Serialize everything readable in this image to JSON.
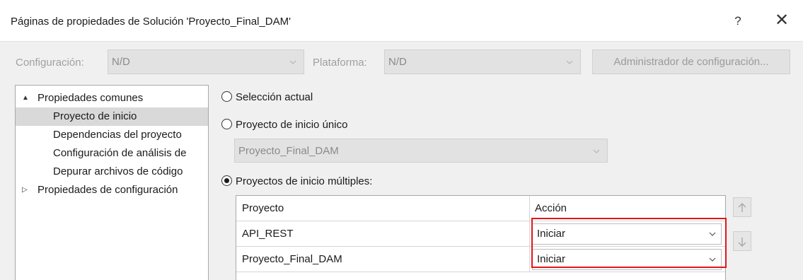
{
  "window": {
    "title": "Páginas de propiedades de Solución 'Proyecto_Final_DAM'",
    "help_label": "?",
    "close_label": "✕"
  },
  "toolbar": {
    "configuracion_label": "Configuración:",
    "configuracion_value": "N/D",
    "plataforma_label": "Plataforma:",
    "plataforma_value": "N/D",
    "admin_button": "Administrador de configuración..."
  },
  "tree": {
    "items": [
      {
        "label": "Propiedades comunes",
        "expander": "▲"
      },
      {
        "label": "Proyecto de inicio"
      },
      {
        "label": "Dependencias del proyecto"
      },
      {
        "label": "Configuración de análisis de"
      },
      {
        "label": "Depurar archivos de código"
      },
      {
        "label": "Propiedades de configuración",
        "expander": "▷"
      }
    ]
  },
  "startup": {
    "option_current": "Selección actual",
    "option_single": "Proyecto de inicio único",
    "single_value": "Proyecto_Final_DAM",
    "option_multiple": "Proyectos de inicio múltiples:"
  },
  "grid": {
    "col_project": "Proyecto",
    "col_action": "Acción",
    "rows": [
      {
        "project": "API_REST",
        "action": "Iniciar"
      },
      {
        "project": "Proyecto_Final_DAM",
        "action": "Iniciar"
      }
    ]
  },
  "colors": {
    "highlight": "#e3161a",
    "selected_item": "#d9d9d9"
  }
}
